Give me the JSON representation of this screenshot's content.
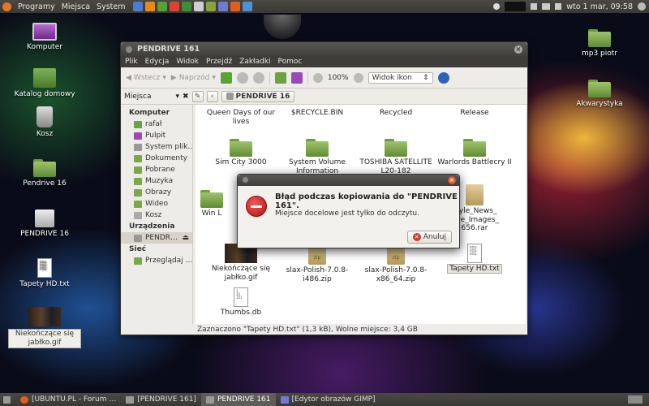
{
  "top_panel": {
    "menus": [
      "Programy",
      "Miejsca",
      "System"
    ],
    "clock": "wto 1 mar, 09:58"
  },
  "desktop_left": [
    {
      "label": "Komputer"
    },
    {
      "label": "Katalog domowy"
    },
    {
      "label": "Kosz"
    },
    {
      "label": "Pendrive 16"
    },
    {
      "label": "PENDRIVE 16"
    },
    {
      "label": "Tapety HD.txt"
    },
    {
      "label": "Niekończące się jabłko.gif"
    }
  ],
  "desktop_right": [
    {
      "label": "mp3 piotr"
    },
    {
      "label": "Akwarystyka"
    }
  ],
  "file_manager": {
    "title": "PENDRIVE 161",
    "menu": [
      "Plik",
      "Edycja",
      "Widok",
      "Przejdź",
      "Zakładki",
      "Pomoc"
    ],
    "toolbar": {
      "back": "Wstecz",
      "forward": "Naprzód",
      "zoom": "100%",
      "view": "Widok ikon"
    },
    "places_label": "Miejsca",
    "path": "PENDRIVE 16",
    "sidebar": {
      "computer_header": "Komputer",
      "computer_items": [
        "rafał",
        "Pulpit",
        "System plik…",
        "Dokumenty",
        "Pobrane",
        "Muzyka",
        "Obrazy",
        "Wideo",
        "Kosz"
      ],
      "devices_header": "Urządzenia",
      "device_items": [
        "PENDR…"
      ],
      "network_header": "Sieć",
      "network_items": [
        "Przeglądaj …"
      ]
    },
    "items": [
      {
        "label": "Queen Days of our lives"
      },
      {
        "label": "$RECYCLE.BIN"
      },
      {
        "label": "Recycled"
      },
      {
        "label": "Release"
      },
      {
        "label": "Sim City 3000"
      },
      {
        "label": "System Volume Information"
      },
      {
        "label": "TOSHIBA SATELLITE L20-182"
      },
      {
        "label": "Warlords Battlecry II"
      },
      {
        "label": "Win L"
      },
      {
        "label": "style_News_ ture_Images_ 656.rar"
      },
      {
        "label": "Niekończące się jabłko.gif"
      },
      {
        "label": "slax-Polish-7.0.8-i486.zip"
      },
      {
        "label": "slax-Polish-7.0.8-x86_64.zip"
      },
      {
        "label": "Tapety HD.txt"
      },
      {
        "label": "Thumbs.db"
      }
    ],
    "status": "Zaznaczono \"Tapety HD.txt\" (1,3 kB), Wolne miejsce: 3,4 GB"
  },
  "dialog": {
    "heading": "Błąd podczas kopiowania do \"PENDRIVE 161\".",
    "message": "Miejsce docelowe jest tylko do odczytu.",
    "cancel": "Anuluj"
  },
  "taskbar": [
    {
      "label": "[UBUNTU.PL - Forum …"
    },
    {
      "label": "[PENDRIVE 161]"
    },
    {
      "label": "PENDRIVE 161"
    },
    {
      "label": "[Edytor obrazów GIMP]"
    }
  ]
}
